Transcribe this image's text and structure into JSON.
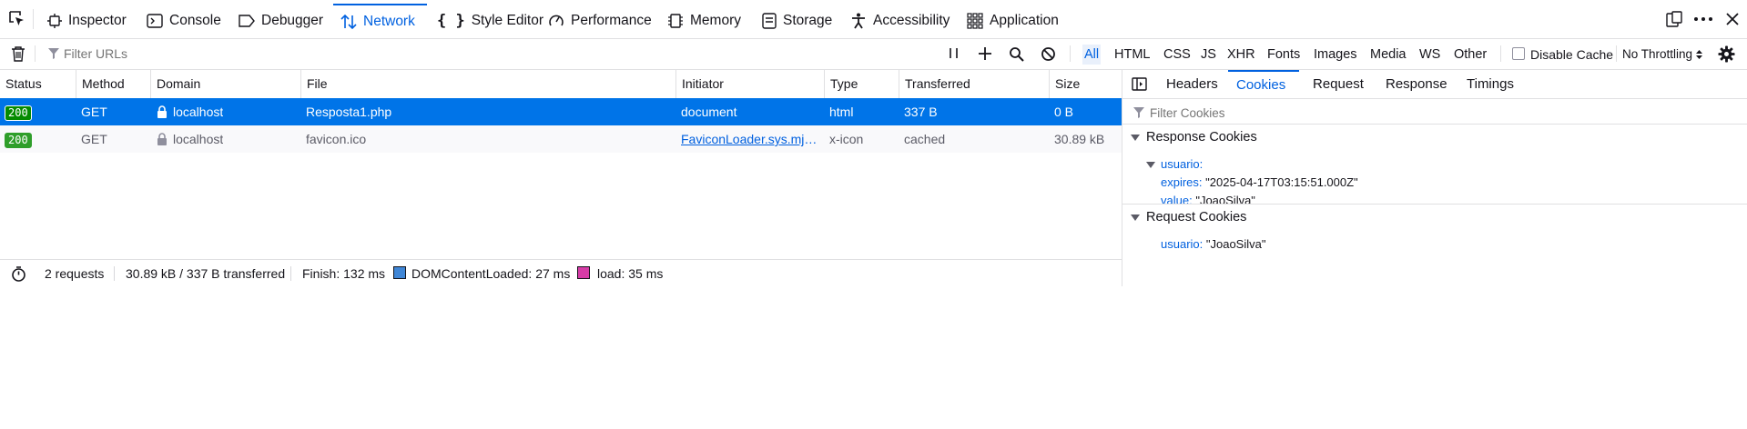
{
  "toolbar": {
    "tabs": [
      {
        "label": "Inspector",
        "icon": "inspector-icon"
      },
      {
        "label": "Console",
        "icon": "console-icon"
      },
      {
        "label": "Debugger",
        "icon": "debugger-icon"
      },
      {
        "label": "Network",
        "icon": "network-icon",
        "selected": true
      },
      {
        "label": "Style Editor",
        "icon": "style-editor-icon"
      },
      {
        "label": "Performance",
        "icon": "performance-icon"
      },
      {
        "label": "Memory",
        "icon": "memory-icon"
      },
      {
        "label": "Storage",
        "icon": "storage-icon"
      },
      {
        "label": "Accessibility",
        "icon": "accessibility-icon"
      },
      {
        "label": "Application",
        "icon": "application-icon"
      }
    ]
  },
  "filterbar": {
    "placeholder": "Filter URLs",
    "types": [
      "All",
      "HTML",
      "CSS",
      "JS",
      "XHR",
      "Fonts",
      "Images",
      "Media",
      "WS",
      "Other"
    ],
    "active_type": "All",
    "disable_cache_label": "Disable Cache",
    "throttling_label": "No Throttling"
  },
  "table": {
    "columns": [
      "Status",
      "Method",
      "Domain",
      "File",
      "Initiator",
      "Type",
      "Transferred",
      "Size"
    ],
    "rows": [
      {
        "status": "200",
        "method": "GET",
        "domain": "localhost",
        "file": "Resposta1.php",
        "initiator": "document",
        "type": "html",
        "transferred": "337 B",
        "size": "0 B"
      },
      {
        "status": "200",
        "method": "GET",
        "domain": "localhost",
        "file": "favicon.ico",
        "initiator": "FaviconLoader.sys.mjs:...",
        "type": "x-icon",
        "transferred": "cached",
        "size": "30.89 kB"
      }
    ]
  },
  "summary": {
    "requests": "2 requests",
    "transferred": "30.89 kB / 337 B transferred",
    "finish": "Finish: 132 ms",
    "dom_content_loaded": "DOMContentLoaded: 27 ms",
    "load": "load: 35 ms",
    "colors": {
      "dom": "#3f86d6",
      "load": "#d73ca7"
    }
  },
  "details": {
    "tabs": [
      "Headers",
      "Cookies",
      "Request",
      "Response",
      "Timings"
    ],
    "active_tab": "Cookies",
    "filter_placeholder": "Filter Cookies",
    "response_section": "Response Cookies",
    "response_cookie_name": "usuario:",
    "response_props": [
      {
        "key": "expires:",
        "value": "\"2025-04-17T03:15:51.000Z\""
      },
      {
        "key": "value:",
        "value": "\"JoaoSilva\""
      }
    ],
    "request_section": "Request Cookies",
    "request_cookie": {
      "key": "usuario:",
      "value": "\"JoaoSilva\""
    }
  },
  "colors": {
    "accent": "#0061e0",
    "selected_row": "#0074e8",
    "status_ok": "#058b00"
  }
}
